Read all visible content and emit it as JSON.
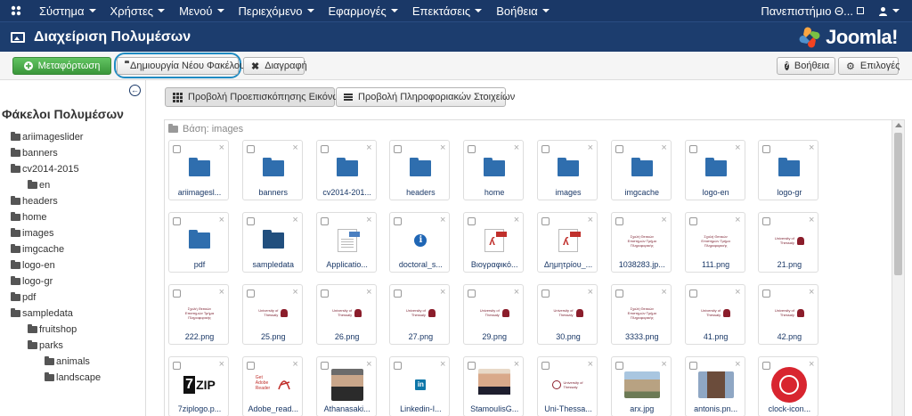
{
  "navbar": {
    "menus": [
      {
        "label": "Σύστημα"
      },
      {
        "label": "Χρήστες"
      },
      {
        "label": "Μενού"
      },
      {
        "label": "Περιεχόμενο"
      },
      {
        "label": "Εφαρμογές"
      },
      {
        "label": "Επεκτάσεις"
      },
      {
        "label": "Βοήθεια"
      }
    ],
    "site_label": "Πανεπιστήμιο Θ...",
    "logo_icon": "joomla-icon",
    "user_icon": "user-icon"
  },
  "header": {
    "title": "Διαχείριση Πολυμέσων",
    "brand": "Joomla!",
    "icon": "image-icon"
  },
  "toolbar": {
    "upload_label": "Μεταφόρτωση",
    "new_folder_label": "Δημιουργία Νέου Φακέλου",
    "delete_label": "Διαγραφή",
    "help_label": "Βοήθεια",
    "options_label": "Επιλογές"
  },
  "sidebar": {
    "title": "Φάκελοι Πολυμέσων",
    "tree": [
      {
        "label": "ariimageslider",
        "level": 0
      },
      {
        "label": "banners",
        "level": 0
      },
      {
        "label": "cv2014-2015",
        "level": 0
      },
      {
        "label": "en",
        "level": 1
      },
      {
        "label": "headers",
        "level": 0
      },
      {
        "label": "home",
        "level": 0
      },
      {
        "label": "images",
        "level": 0
      },
      {
        "label": "imgcache",
        "level": 0
      },
      {
        "label": "logo-en",
        "level": 0
      },
      {
        "label": "logo-gr",
        "level": 0
      },
      {
        "label": "pdf",
        "level": 0
      },
      {
        "label": "sampledata",
        "level": 0
      },
      {
        "label": "fruitshop",
        "level": 1
      },
      {
        "label": "parks",
        "level": 1
      },
      {
        "label": "animals",
        "level": 2
      },
      {
        "label": "landscape",
        "level": 2
      }
    ]
  },
  "main": {
    "view_thumbnails": "Προβολή Προεπισκόπησης Εικόνων",
    "view_details": "Προβολή Πληροφοριακών Στοιχείων",
    "breadcrumb": "Βάση: images",
    "items": [
      {
        "name": "ariimagesl...",
        "kind": "folder"
      },
      {
        "name": "banners",
        "kind": "folder"
      },
      {
        "name": "cv2014-201...",
        "kind": "folder"
      },
      {
        "name": "headers",
        "kind": "folder"
      },
      {
        "name": "home",
        "kind": "folder"
      },
      {
        "name": "images",
        "kind": "folder"
      },
      {
        "name": "imgcache",
        "kind": "folder"
      },
      {
        "name": "logo-en",
        "kind": "folder"
      },
      {
        "name": "logo-gr",
        "kind": "folder"
      },
      {
        "name": "pdf",
        "kind": "folder"
      },
      {
        "name": "sampledata",
        "kind": "folder-dark"
      },
      {
        "name": "Applicatio...",
        "kind": "doc"
      },
      {
        "name": "doctoral_s...",
        "kind": "info"
      },
      {
        "name": "Βιογραφικό...",
        "kind": "pdf"
      },
      {
        "name": "Δημητρίου_...",
        "kind": "pdf"
      },
      {
        "name": "1038283.jp...",
        "kind": "greek-logo"
      },
      {
        "name": "111.png",
        "kind": "greek-logo"
      },
      {
        "name": "21.png",
        "kind": "uth-logo"
      },
      {
        "name": "222.png",
        "kind": "greek-logo"
      },
      {
        "name": "25.png",
        "kind": "uth-logo"
      },
      {
        "name": "26.png",
        "kind": "uth-logo"
      },
      {
        "name": "27.png",
        "kind": "uth-logo"
      },
      {
        "name": "29.png",
        "kind": "uth-logo"
      },
      {
        "name": "30.png",
        "kind": "uth-logo"
      },
      {
        "name": "3333.png",
        "kind": "greek-logo"
      },
      {
        "name": "41.png",
        "kind": "uth-logo"
      },
      {
        "name": "42.png",
        "kind": "uth-logo"
      },
      {
        "name": "7ziplogo.p...",
        "kind": "zip"
      },
      {
        "name": "Adobe_read...",
        "kind": "adobe"
      },
      {
        "name": "Athanasaki...",
        "kind": "photo-a"
      },
      {
        "name": "Linkedin-I...",
        "kind": "linkedin"
      },
      {
        "name": "StamoulisG...",
        "kind": "photo-b"
      },
      {
        "name": "Uni-Thessa...",
        "kind": "uth-round"
      },
      {
        "name": "arx.jpg",
        "kind": "photo-c"
      },
      {
        "name": "antonis.pn...",
        "kind": "photo-d"
      },
      {
        "name": "clock-icon...",
        "kind": "clock"
      }
    ],
    "logo_text_uth": "University of Thessaly",
    "logo_text_greek": "Σχολή Θετικών Επιστημών Τμήμα Πληροφορικής",
    "zip_text": "ZIP",
    "adobe_text": "Get Adobe Reader"
  },
  "colors": {
    "navbar": "#1a3867",
    "header": "#1c3d6e",
    "folder": "#2f6eae",
    "success": "#46a546",
    "highlight": "#1e8bc3"
  }
}
